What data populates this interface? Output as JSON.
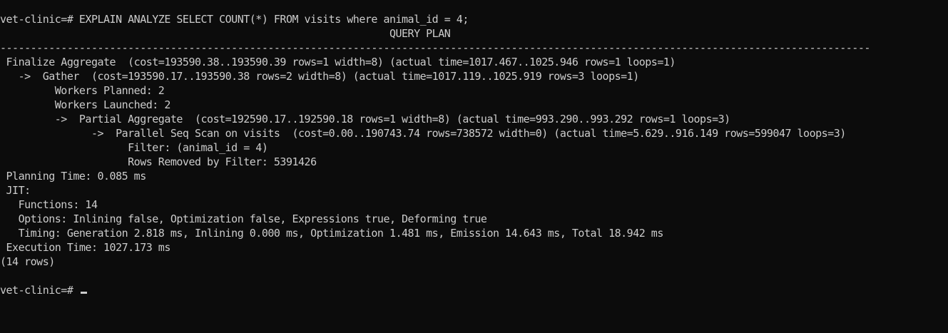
{
  "terminal": {
    "lines": [
      "vet-clinic=# EXPLAIN ANALYZE SELECT COUNT(*) FROM visits where animal_id = 4;",
      "                                                                QUERY PLAN",
      "-----------------------------------------------------------------------------------------------------------------------------------------------",
      " Finalize Aggregate  (cost=193590.38..193590.39 rows=1 width=8) (actual time=1017.467..1025.946 rows=1 loops=1)",
      "   ->  Gather  (cost=193590.17..193590.38 rows=2 width=8) (actual time=1017.119..1025.919 rows=3 loops=1)",
      "         Workers Planned: 2",
      "         Workers Launched: 2",
      "         ->  Partial Aggregate  (cost=192590.17..192590.18 rows=1 width=8) (actual time=993.290..993.292 rows=1 loops=3)",
      "               ->  Parallel Seq Scan on visits  (cost=0.00..190743.74 rows=738572 width=0) (actual time=5.629..916.149 rows=599047 loops=3)",
      "                     Filter: (animal_id = 4)",
      "                     Rows Removed by Filter: 5391426",
      " Planning Time: 0.085 ms",
      " JIT:",
      "   Functions: 14",
      "   Options: Inlining false, Optimization false, Expressions true, Deforming true",
      "   Timing: Generation 2.818 ms, Inlining 0.000 ms, Optimization 1.481 ms, Emission 14.643 ms, Total 18.942 ms",
      " Execution Time: 1027.173 ms",
      "(14 rows)",
      "",
      "vet-clinic=# "
    ]
  }
}
